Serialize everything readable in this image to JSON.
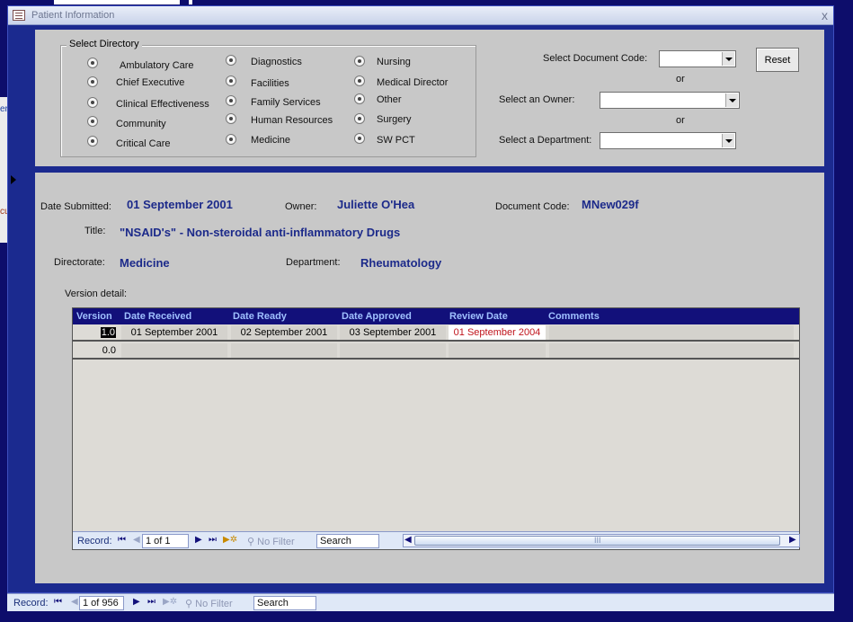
{
  "window": {
    "title": "Patient Information",
    "close_label": "x"
  },
  "background": {
    "edge_texts": [
      "er",
      "cu"
    ]
  },
  "directory": {
    "label": "Select Directory",
    "columns": [
      [
        "Ambulatory Care",
        "Chief Executive",
        "Clinical Effectiveness",
        "Community",
        "Critical Care"
      ],
      [
        "Diagnostics",
        "Facilities",
        "Family Services",
        "Human Resources",
        "Medicine"
      ],
      [
        "Nursing",
        "Medical Director",
        "Other",
        "Surgery",
        "SW PCT"
      ]
    ]
  },
  "filters": {
    "doc_code_label": "Select Document Code:",
    "or1": "or",
    "owner_label": "Select an Owner:",
    "or2": "or",
    "department_label": "Select a Department:",
    "reset_label": "Reset"
  },
  "record": {
    "date_submitted_label": "Date Submitted:",
    "date_submitted": "01 September 2001",
    "owner_label": "Owner:",
    "owner": "Juliette O'Hea",
    "doc_code_label": "Document Code:",
    "doc_code": "MNew029f",
    "title_label": "Title:",
    "title": "\"NSAID's\" - Non-steroidal anti-inflammatory Drugs",
    "directorate_label": "Directorate:",
    "directorate": "Medicine",
    "department_label": "Department:",
    "department": "Rheumatology"
  },
  "versions": {
    "label": "Version detail:",
    "columns": [
      "Version",
      "Date Received",
      "Date Ready",
      "Date Approved",
      "Review Date",
      "Comments"
    ],
    "rows": [
      {
        "version": "1.0",
        "received": "01 September 2001",
        "ready": "02 September 2001",
        "approved": "03 September 2001",
        "review": "01 September 2004",
        "comments": ""
      },
      {
        "version": "0.0",
        "received": "",
        "ready": "",
        "approved": "",
        "review": "",
        "comments": ""
      }
    ],
    "review_color": "#c0141c"
  },
  "sub_nav": {
    "record_label": "Record:",
    "position": "1 of 1",
    "filter": "No Filter",
    "search": "Search",
    "scroll_marker": "III"
  },
  "main_nav": {
    "record_label": "Record:",
    "position": "1 of 956",
    "filter": "No Filter",
    "search": "Search"
  }
}
